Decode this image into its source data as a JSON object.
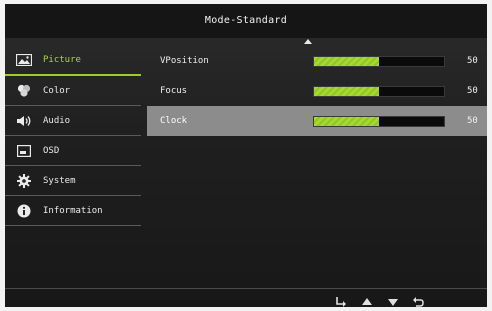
{
  "osd": {
    "title": "Mode-Standard",
    "accent_color": "#a6d930",
    "sidebar": {
      "items": [
        {
          "label": "Picture",
          "icon": "picture-icon",
          "active": true
        },
        {
          "label": "Color",
          "icon": "color-wheel-icon",
          "active": false
        },
        {
          "label": "Audio",
          "icon": "speaker-icon",
          "active": false
        },
        {
          "label": "OSD",
          "icon": "osd-icon",
          "active": false
        },
        {
          "label": "System",
          "icon": "gear-icon",
          "active": false
        },
        {
          "label": "Information",
          "icon": "info-icon",
          "active": false
        }
      ]
    },
    "settings": [
      {
        "label": "VPosition",
        "value": "50",
        "level_percent": 50,
        "selected": false
      },
      {
        "label": "Focus",
        "value": "50",
        "level_percent": 50,
        "selected": false
      },
      {
        "label": "Clock",
        "value": "50",
        "level_percent": 50,
        "selected": true
      }
    ],
    "nav_icons": [
      "enter-icon",
      "up-arrow-icon",
      "down-arrow-icon",
      "back-icon"
    ]
  }
}
